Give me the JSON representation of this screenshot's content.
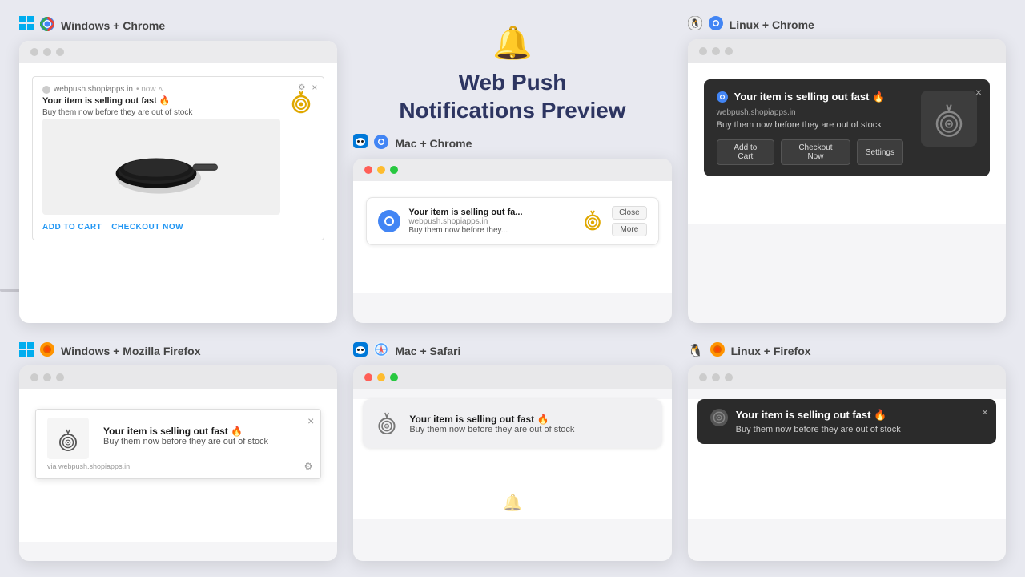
{
  "header": {
    "icon": "🔔",
    "title_line1": "Web Push",
    "title_line2": "Notifications Preview"
  },
  "notification": {
    "title": "Your item is selling out fast 🔥",
    "body": "Buy them now before they are out of stock",
    "site": "webpush.shopiapps.in",
    "time": "now",
    "logo": "⚡",
    "add_to_cart": "ADD TO CART",
    "checkout_now": "CHECKOUT NOW",
    "close": "×",
    "more": "More",
    "close_btn": "Close",
    "settings": "Settings",
    "add_to_cart_btn": "Add to Cart",
    "checkout_now_btn": "Checkout Now"
  },
  "platforms": {
    "win_chrome": "Windows + Chrome",
    "mac_chrome": "Mac + Chrome",
    "linux_chrome": "Linux + Chrome",
    "win_firefox": "Windows + Mozilla Firefox",
    "mac_safari": "Mac + Safari",
    "linux_firefox": "Linux + Firefox"
  },
  "dots": {
    "d1": "●",
    "d2": "●",
    "d3": "●"
  },
  "buttons": {
    "close_x": "×",
    "gear": "⚙"
  },
  "via": "via webpush.shopiapps.in"
}
